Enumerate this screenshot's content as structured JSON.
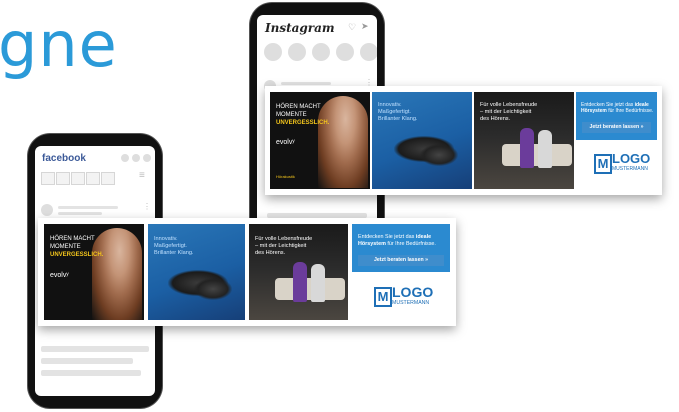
{
  "heading": "gne",
  "instagram_phone": {
    "app_name": "Instagram"
  },
  "facebook_phone": {
    "app_name": "facebook"
  },
  "ad": {
    "card1": {
      "line1": "HÖREN MACHT",
      "line2": "MOMENTE",
      "line3": "UNVERGESSLICH.",
      "brand": "evolvʸ",
      "seal": "Hörakustik"
    },
    "card2": {
      "line1": "Innovativ.",
      "line2": "Maßgefertigt.",
      "line3": "Brillanter Klang."
    },
    "card3": {
      "line1": "Für volle Lebensfreude",
      "line2": "– mit der Leichtigkeit",
      "line3": "des Hörens."
    },
    "card4": {
      "text_a": "Entdecken Sie jetzt das",
      "text_bold1": "ideale",
      "text_bold2": "Hörsystem",
      "text_b": "für Ihre Bedürfnisse.",
      "button": "Jetzt beraten lassen »",
      "logo_letter": "M",
      "logo_word": "LOGO",
      "logo_sub": "MUSTERMANN"
    }
  },
  "colors": {
    "accent": "#2b9ad8",
    "brand_blue": "#1e6fb6",
    "highlight": "#f3c51c"
  },
  "icons": [
    "heart-icon",
    "send-icon",
    "more-icon",
    "menu-icon"
  ]
}
